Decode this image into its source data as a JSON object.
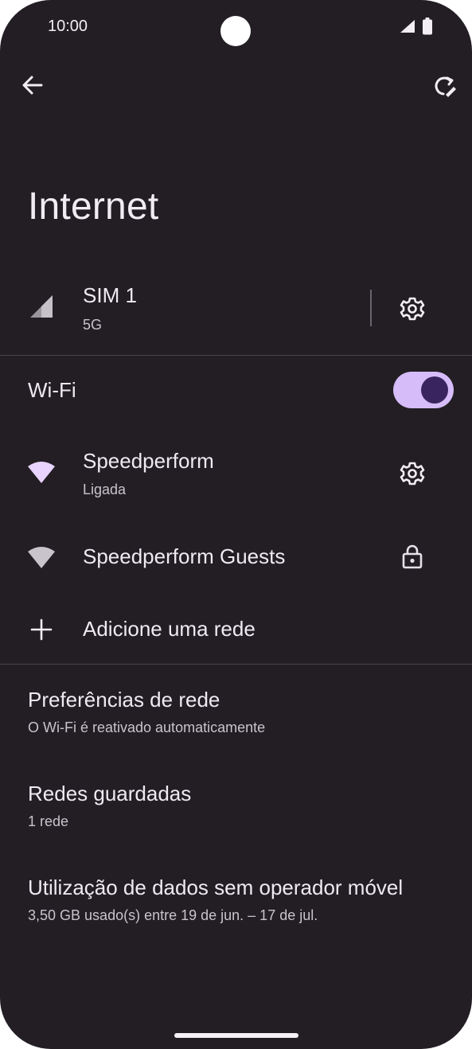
{
  "status_bar": {
    "time": "10:00"
  },
  "page": {
    "title": "Internet"
  },
  "sim": {
    "name": "SIM 1",
    "network": "5G"
  },
  "wifi": {
    "label": "Wi-Fi",
    "enabled": true
  },
  "networks": [
    {
      "name": "Speedperform",
      "status": "Ligada"
    },
    {
      "name": "Speedperform Guests"
    }
  ],
  "add_network": {
    "label": "Adicione uma rede"
  },
  "preferences": [
    {
      "title": "Preferências de rede",
      "subtitle": "O Wi-Fi é reativado automaticamente"
    },
    {
      "title": "Redes guardadas",
      "subtitle": "1 rede"
    },
    {
      "title": "Utilização de dados sem operador móvel",
      "subtitle": "3,50 GB usado(s) entre 19 de jun. – 17 de jul."
    }
  ],
  "icons": {
    "back": "arrow-left-icon",
    "reset": "reset-network-icon",
    "signal": "cellular-signal-icon",
    "settings": "gear-icon",
    "wifi": "wifi-icon",
    "lock": "lock-icon",
    "add": "plus-icon"
  },
  "colors": {
    "background": "#221e24",
    "accent_track": "#d6bcf8",
    "accent_knob": "#3a2460",
    "wifi_connected": "#e8d4ff"
  }
}
